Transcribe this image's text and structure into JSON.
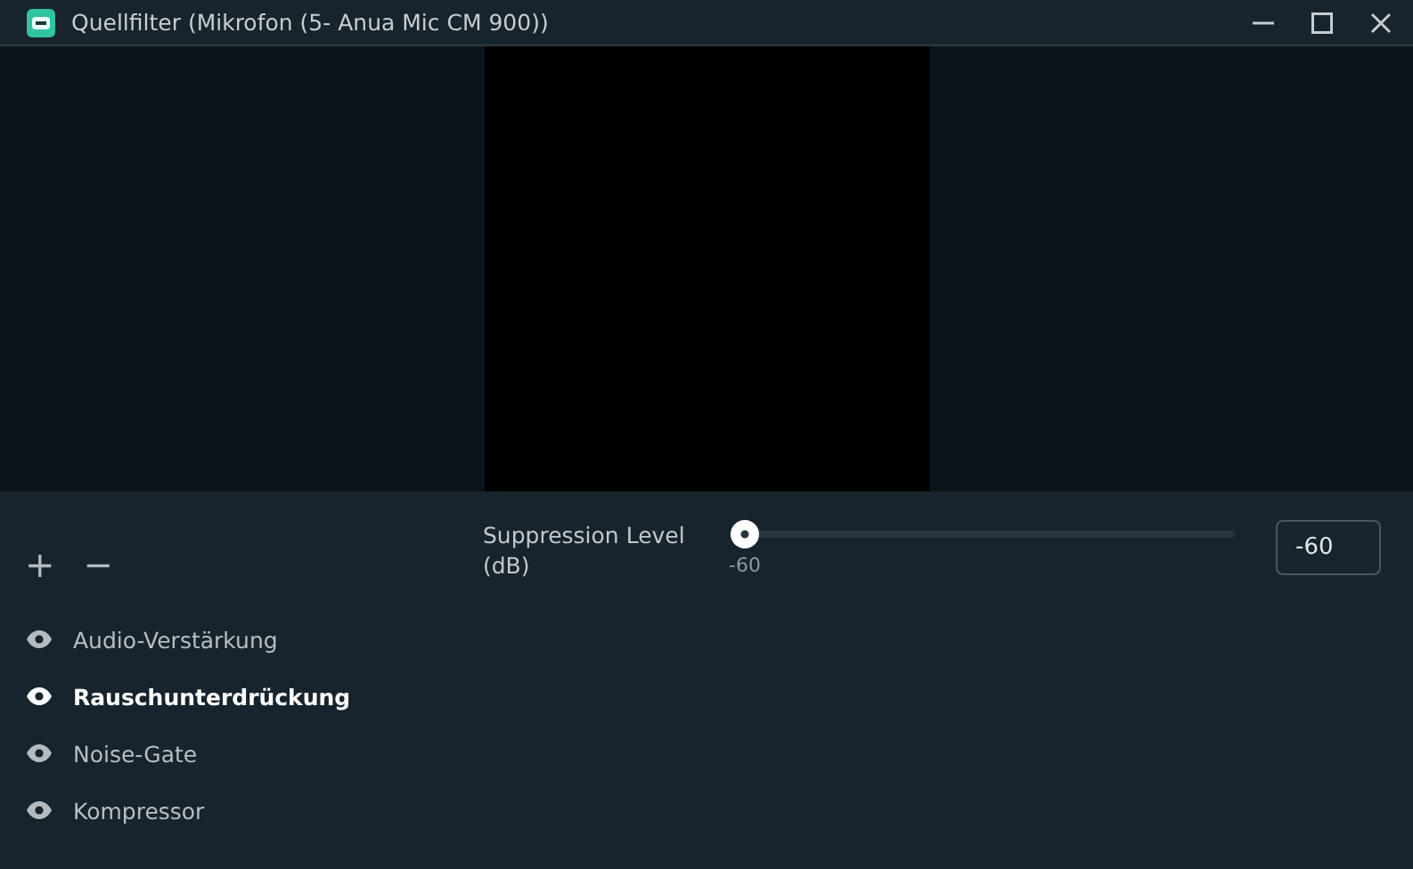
{
  "window": {
    "title": "Quellfilter (Mikrofon (5- Anua Mic CM 900))"
  },
  "toolbar": {
    "add": "+",
    "remove": "−"
  },
  "filters": [
    {
      "name": "Audio-Verstärkung",
      "visible": true,
      "selected": false
    },
    {
      "name": "Rauschunterdrückung",
      "visible": true,
      "selected": true
    },
    {
      "name": "Noise-Gate",
      "visible": true,
      "selected": false
    },
    {
      "name": "Kompressor",
      "visible": true,
      "selected": false
    }
  ],
  "settings": {
    "label": "Suppression Level (dB)",
    "slider": {
      "level": 0,
      "reading": "-60"
    },
    "value": "-60"
  }
}
